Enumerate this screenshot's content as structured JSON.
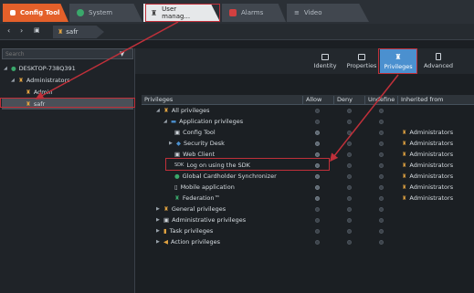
{
  "tabs": [
    {
      "label": "Config Tool"
    },
    {
      "label": "System"
    },
    {
      "label": "User manag..."
    },
    {
      "label": "Alarms"
    },
    {
      "label": "Video"
    }
  ],
  "breadcrumb": {
    "label": "safr"
  },
  "search": {
    "placeholder": "Search"
  },
  "tree": {
    "root": "DESKTOP-738Q391",
    "group": "Administrators",
    "items": [
      "Admin",
      "safr"
    ]
  },
  "toolbar": {
    "identity": "Identity",
    "properties": "Properties",
    "privileges": "Privileges",
    "advanced": "Advanced"
  },
  "grid": {
    "headers": [
      "Privileges",
      "Allow",
      "Deny",
      "Undefine",
      "Inherited from"
    ],
    "rows": [
      {
        "label": "All privileges",
        "inherited": ""
      },
      {
        "label": "Application privileges",
        "inherited": ""
      },
      {
        "label": "Config Tool",
        "inherited": "Administrators"
      },
      {
        "label": "Security Desk",
        "inherited": "Administrators"
      },
      {
        "label": "Web Client",
        "inherited": "Administrators"
      },
      {
        "label": "Log on using the SDK",
        "inherited": "Administrators"
      },
      {
        "label": "Global Cardholder Synchronizer",
        "inherited": "Administrators"
      },
      {
        "label": "Mobile application",
        "inherited": "Administrators"
      },
      {
        "label": "Federation™",
        "inherited": "Administrators"
      },
      {
        "label": "General privileges",
        "inherited": ""
      },
      {
        "label": "Administrative privileges",
        "inherited": ""
      },
      {
        "label": "Task privileges",
        "inherited": ""
      },
      {
        "label": "Action privileges",
        "inherited": ""
      }
    ],
    "sdk_icon_text": "SDK"
  },
  "colors": {
    "accent": "#4b90cf",
    "config_tab": "#e4602a",
    "callout": "#c0303a"
  }
}
